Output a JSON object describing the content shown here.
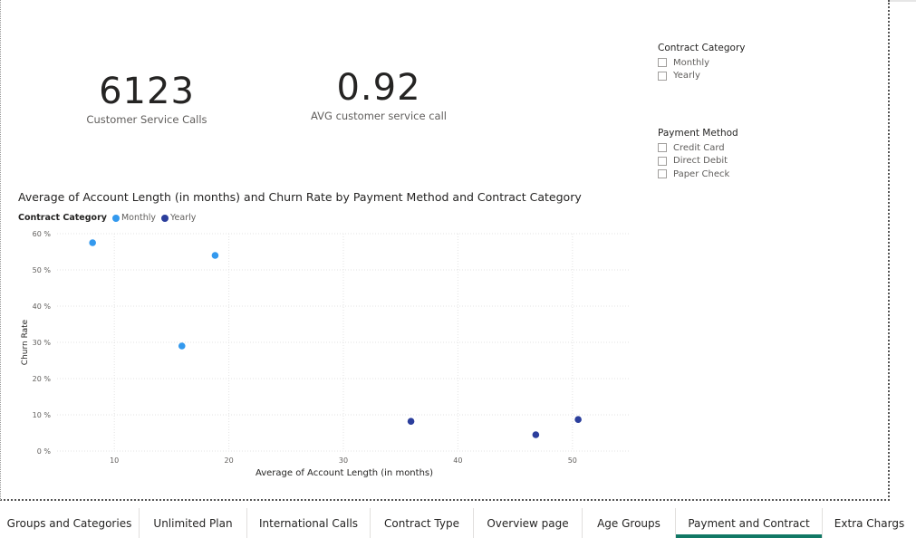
{
  "cards": [
    {
      "value": "6123",
      "label": "Customer Service Calls"
    },
    {
      "value": "0.92",
      "label": "AVG customer service call"
    }
  ],
  "slicers": {
    "contract": {
      "title": "Contract Category",
      "options": [
        "Monthly",
        "Yearly"
      ]
    },
    "payment": {
      "title": "Payment Method",
      "options": [
        "Credit Card",
        "Direct Debit",
        "Paper Check"
      ]
    }
  },
  "chart": {
    "title": "Average of Account Length (in months) and Churn Rate by Payment Method and Contract Category",
    "legend_title": "Contract Category",
    "legend_items": [
      "Monthly",
      "Yearly"
    ]
  },
  "chart_data": {
    "type": "scatter",
    "title": "Average of Account Length (in months) and Churn Rate by Payment Method and Contract Category",
    "xlabel": "Average of Account Length (in months)",
    "ylabel": "Churn Rate",
    "xlim": [
      5,
      55
    ],
    "ylim": [
      0,
      60
    ],
    "x_ticks": [
      "10",
      "20",
      "30",
      "40",
      "50"
    ],
    "y_ticks": [
      "0 %",
      "10 %",
      "20 %",
      "30 %",
      "40 %",
      "50 %",
      "60 %"
    ],
    "grid": true,
    "legend_position": "top-left",
    "series": [
      {
        "name": "Monthly",
        "color": "#3399ee",
        "points": [
          [
            8.1,
            57.5
          ],
          [
            18.8,
            54
          ],
          [
            15.9,
            29
          ]
        ]
      },
      {
        "name": "Yearly",
        "color": "#2b3e9c",
        "points": [
          [
            35.9,
            8.2
          ],
          [
            46.8,
            4.5
          ],
          [
            50.5,
            8.7
          ]
        ]
      }
    ]
  },
  "tabs": [
    {
      "label": "Groups and Categories",
      "active": false
    },
    {
      "label": "Unlimited Plan",
      "active": false
    },
    {
      "label": "International Calls",
      "active": false
    },
    {
      "label": "Contract Type",
      "active": false
    },
    {
      "label": "Overview page",
      "active": false
    },
    {
      "label": "Age Groups",
      "active": false
    },
    {
      "label": "Payment and Contract",
      "active": true
    },
    {
      "label": "Extra Chargs",
      "active": false
    }
  ]
}
